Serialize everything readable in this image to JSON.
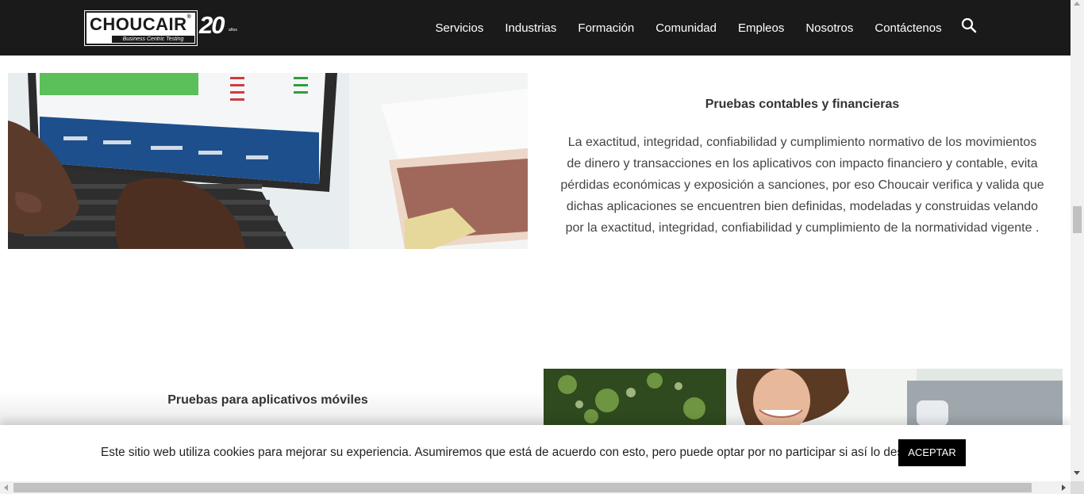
{
  "header": {
    "logo": {
      "word": "CHOUCAIR",
      "registered": "®",
      "tagline": "Business Centric Testing",
      "anniversary": "20",
      "anniversary_suffix": "años"
    },
    "nav": [
      {
        "label": "Servicios"
      },
      {
        "label": "Industrias"
      },
      {
        "label": "Formación"
      },
      {
        "label": "Comunidad"
      },
      {
        "label": "Empleos"
      },
      {
        "label": "Nosotros"
      },
      {
        "label": "Contáctenos"
      }
    ],
    "search_icon": "search-icon"
  },
  "section_financial": {
    "title": "Pruebas contables y financieras",
    "text": "La exactitud, integridad, confiabilidad y cumplimiento normativo de los movimientos de dinero y transacciones en los aplicativos con impacto financiero y contable, evita pérdidas económicas y exposición a sanciones, por eso Choucair verifica y valida que dichas aplicaciones se encuentren bien definidas, modeladas y construidas velando por la  exactitud, integridad, confiabilidad y cumplimiento de la normatividad vigente ."
  },
  "section_mobile": {
    "title": "Pruebas para aplicativos móviles"
  },
  "cookie_bar": {
    "text": "Este sitio web utiliza cookies para mejorar su experiencia. Asumiremos que está de acuerdo con esto, pero puede optar por no participar si así lo desea.",
    "accept_label": "ACEPTAR"
  },
  "colors": {
    "header_bg": "#1a1a1a",
    "accept_bg": "#000000",
    "title_text": "#333333",
    "body_text": "#444444"
  }
}
